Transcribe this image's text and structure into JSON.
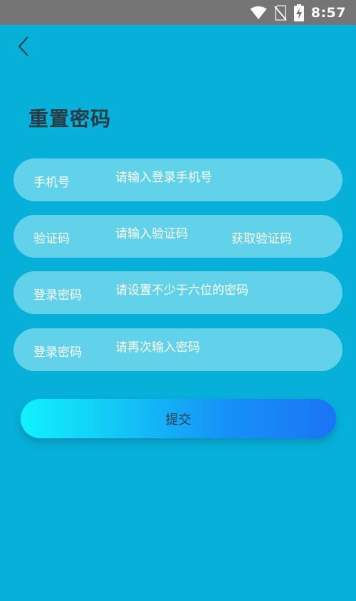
{
  "status_bar": {
    "time": "8:57",
    "icons": [
      "wifi-icon",
      "sim-off-icon",
      "battery-charging-icon"
    ]
  },
  "header": {
    "back_icon": "chevron-left-icon",
    "title": "重置密码"
  },
  "form": {
    "phone": {
      "label": "手机号",
      "placeholder": "请输入登录手机号",
      "value": ""
    },
    "code": {
      "label": "验证码",
      "placeholder": "请输入验证码",
      "value": "",
      "get_code_label": "获取验证码"
    },
    "password": {
      "label": "登录密码",
      "placeholder": "请设置不少于六位的密码",
      "value": ""
    },
    "password_confirm": {
      "label": "登录密码",
      "placeholder": "请再次输入密码",
      "value": ""
    }
  },
  "submit": {
    "label": "提交"
  },
  "colors": {
    "background": "#07b0d8",
    "status_bar": "#757575",
    "field_bg": "#62d2ea",
    "title_text": "#2a3b44",
    "button_gradient_start": "#10f2fd",
    "button_gradient_end": "#1b74f6"
  }
}
